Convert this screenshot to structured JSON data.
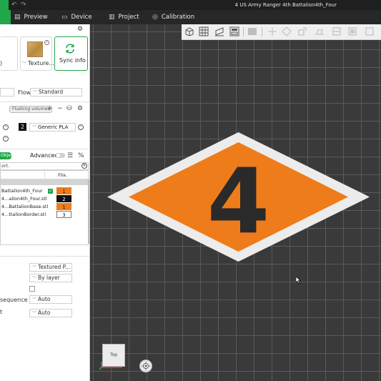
{
  "window": {
    "title": "4 US Army Ranger 4th Battalion4th_Four"
  },
  "menubar": {
    "items": [
      {
        "label": "Preview",
        "icon": "preview-icon"
      },
      {
        "label": "Device",
        "icon": "device-icon"
      },
      {
        "label": "Project",
        "icon": "project-icon"
      },
      {
        "label": "Calibration",
        "icon": "calibration-icon"
      }
    ]
  },
  "sidebar": {
    "texture_label": "Texture...",
    "sync_label": "Sync info",
    "flow_label": "Flow",
    "flow_value": "Standard",
    "flushing_label": "Flushing volumes",
    "filament": {
      "number": "2",
      "name": "Generic PLA"
    },
    "objects_tab": "Objects",
    "advanced_label": "Advanced",
    "search_placeholder": "ort.",
    "fila_header": "Fila.",
    "objects": [
      {
        "name": "Battalion4th_Four",
        "checked": true,
        "filament": "1",
        "color": "#ee7c1a",
        "text_color": "#222222"
      },
      {
        "name": "4...alion4th_Four.stl",
        "checked": false,
        "filament": "2",
        "color": "#111111",
        "text_color": "#ffffff"
      },
      {
        "name": "4...BattalionBase.stl",
        "checked": false,
        "filament": "1",
        "color": "#ee7c1a",
        "text_color": "#222222"
      },
      {
        "name": "4...ttalionBorder.stl",
        "checked": false,
        "filament": "3",
        "color": "#ffffff",
        "text_color": "#222222"
      }
    ],
    "settings": {
      "plate_type_value": "Textured P...",
      "sequence_value": "By layer",
      "print_sequence_label": "sequence",
      "print_sequence_value": "Auto",
      "label_t": "t",
      "t_value": "Auto"
    }
  },
  "canvas": {
    "model_text": "4",
    "viewcube_label": "Top",
    "colors": {
      "orange": "#ee7c1a",
      "border": "#ececec",
      "digit": "#2a2a2a",
      "accent": "#21a64a"
    }
  }
}
